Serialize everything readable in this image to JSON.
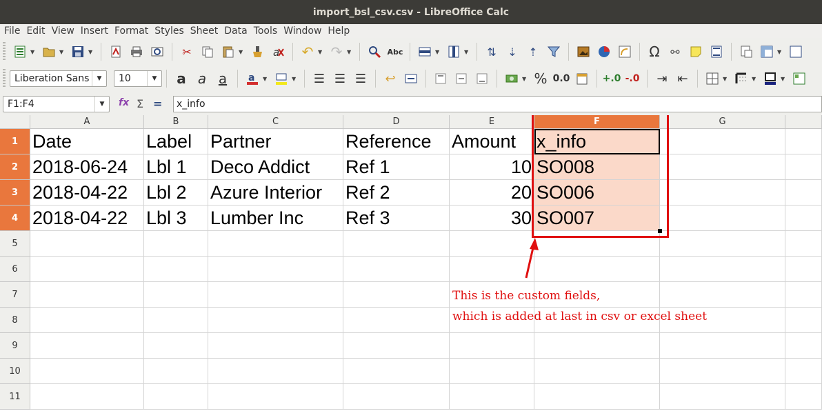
{
  "window": {
    "title": "import_bsl_csv.csv - LibreOffice Calc"
  },
  "menu": [
    "File",
    "Edit",
    "View",
    "Insert",
    "Format",
    "Styles",
    "Sheet",
    "Data",
    "Tools",
    "Window",
    "Help"
  ],
  "toolbar": {
    "font_name": "Liberation Sans",
    "font_size": "10",
    "percent_label": "%",
    "decimal_label": "0.0",
    "abc_label": "Abc",
    "omega_label": "Ω"
  },
  "formula_bar": {
    "name_box": "F1:F4",
    "content": "x_info",
    "sum_icon": "Σ",
    "equals_icon": "="
  },
  "sheet": {
    "columns": [
      "A",
      "B",
      "C",
      "D",
      "E",
      "F",
      "G"
    ],
    "rows": [
      "1",
      "2",
      "3",
      "4",
      "5",
      "6",
      "7",
      "8",
      "9",
      "10",
      "11"
    ],
    "data": [
      [
        "Date",
        "Label",
        "Partner",
        "Reference",
        "Amount",
        "x_info"
      ],
      [
        "2018-06-24",
        "Lbl 1",
        "Deco Addict",
        "Ref 1",
        "10",
        "SO008"
      ],
      [
        "2018-04-22",
        "Lbl 2",
        "Azure Interior",
        "Ref 2",
        "20",
        "SO006"
      ],
      [
        "2018-04-22",
        "Lbl 3",
        "Lumber Inc",
        "Ref 3",
        "30",
        "SO007"
      ]
    ],
    "selected_column": "F",
    "selected_rows": [
      "1",
      "2",
      "3",
      "4"
    ]
  },
  "annotation": {
    "line1": "This is the custom fields,",
    "line2": "which is added at last in csv or excel sheet",
    "color": "#e01010"
  },
  "colors": {
    "selection_header": "#e9773d",
    "selection_fill": "#fbd9c9",
    "titlebar": "#3c3b37"
  }
}
